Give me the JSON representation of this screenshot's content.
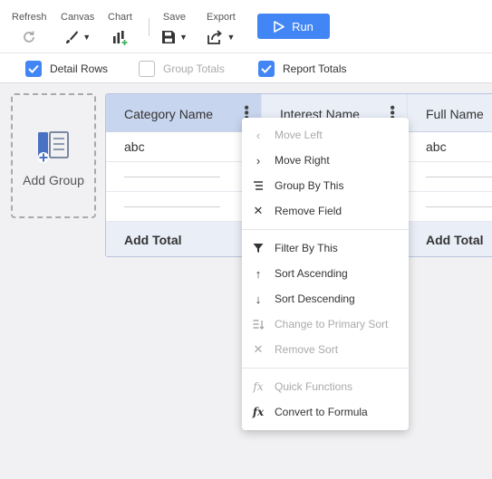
{
  "toolbar": {
    "refresh": "Refresh",
    "canvas": "Canvas",
    "chart": "Chart",
    "save": "Save",
    "export": "Export",
    "run": "Run"
  },
  "options": {
    "detail_rows": "Detail Rows",
    "group_totals": "Group Totals",
    "report_totals": "Report Totals"
  },
  "add_group": "Add Group",
  "columns": {
    "c1": {
      "header": "Category Name",
      "value": "abc",
      "total": "Add Total"
    },
    "c2": {
      "header": "Interest Name"
    },
    "c3": {
      "header": "Full Name",
      "value": "abc",
      "total": "Add Total"
    }
  },
  "menu": {
    "move_left": "Move Left",
    "move_right": "Move Right",
    "group_by": "Group By This",
    "remove_field": "Remove Field",
    "filter_by": "Filter By This",
    "sort_asc": "Sort Ascending",
    "sort_desc": "Sort Descending",
    "primary_sort": "Change to Primary Sort",
    "remove_sort": "Remove Sort",
    "quick_functions": "Quick Functions",
    "convert_formula": "Convert to Formula"
  },
  "colors": {
    "accent": "#4285f4",
    "header_selected": "#c8d5ee",
    "header": "#e9eef7"
  }
}
